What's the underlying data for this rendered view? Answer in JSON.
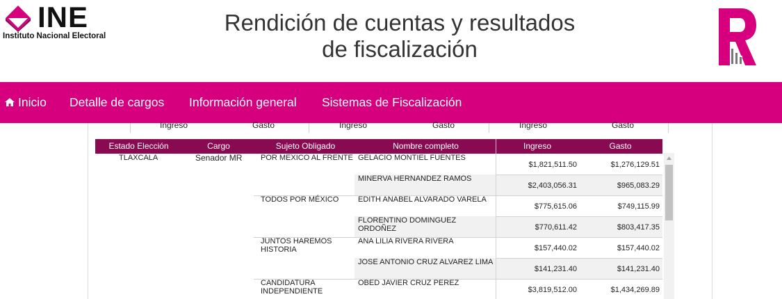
{
  "header": {
    "logo_word": "INE",
    "logo_subtitle": "Instituto Nacional Electoral",
    "title_line1": "Rendición de cuentas y resultados",
    "title_line2": "de fiscalización",
    "brand_color": "#d6007f"
  },
  "nav": {
    "items": [
      {
        "label": "Inicio",
        "icon": "home-icon"
      },
      {
        "label": "Detalle de cargos"
      },
      {
        "label": "Información general"
      },
      {
        "label": "Sistemas de Fiscalización"
      }
    ]
  },
  "top_headers": [
    "Ingreso",
    "Gasto",
    "Ingreso",
    "Gasto",
    "Ingreso",
    "Gasto"
  ],
  "table": {
    "columns": [
      "Estado Elección",
      "Cargo",
      "Sujeto Obligado",
      "Nombre completo",
      "Ingreso",
      "Gasto"
    ],
    "header_color": "#8a0a52",
    "estado": "TLAXCALA",
    "cargo": "Senador MR",
    "groups": [
      {
        "sujeto": [
          "POR MEXICO AL FRENTE"
        ],
        "rows": [
          {
            "nombre": [
              "GELACIO MONTIEL FUENTES"
            ],
            "ingreso": "$1,821,511.50",
            "gasto": "$1,276,129.51"
          },
          {
            "nombre": [
              "MINERVA HERNANDEZ RAMOS"
            ],
            "ingreso": "$2,403,056.31",
            "gasto": "$965,083.29"
          }
        ]
      },
      {
        "sujeto": [
          "TODOS POR MÉXICO"
        ],
        "rows": [
          {
            "nombre": [
              "EDITH ANABEL ALVARADO VARELA"
            ],
            "ingreso": "$775,615.06",
            "gasto": "$749,115.99"
          },
          {
            "nombre": [
              "FLORENTINO DOMINGUEZ",
              "ORDOÑEZ"
            ],
            "ingreso": "$770,611.42",
            "gasto": "$803,417.35"
          }
        ]
      },
      {
        "sujeto": [
          "JUNTOS HAREMOS",
          "HISTORIA"
        ],
        "rows": [
          {
            "nombre": [
              "ANA LILIA RIVERA RIVERA"
            ],
            "ingreso": "$157,440.02",
            "gasto": "$157,440.02"
          },
          {
            "nombre": [
              "JOSE ANTONIO CRUZ ALVAREZ LIMA"
            ],
            "ingreso": "$141,231.40",
            "gasto": "$141,231.40"
          }
        ]
      },
      {
        "sujeto": [
          "CANDIDATURA",
          "INDEPENDIENTE"
        ],
        "rows": [
          {
            "nombre": [
              "OBED JAVIER CRUZ PEREZ"
            ],
            "ingreso": "$3,819,512.00",
            "gasto": "$1,434,269.89"
          }
        ]
      }
    ]
  }
}
